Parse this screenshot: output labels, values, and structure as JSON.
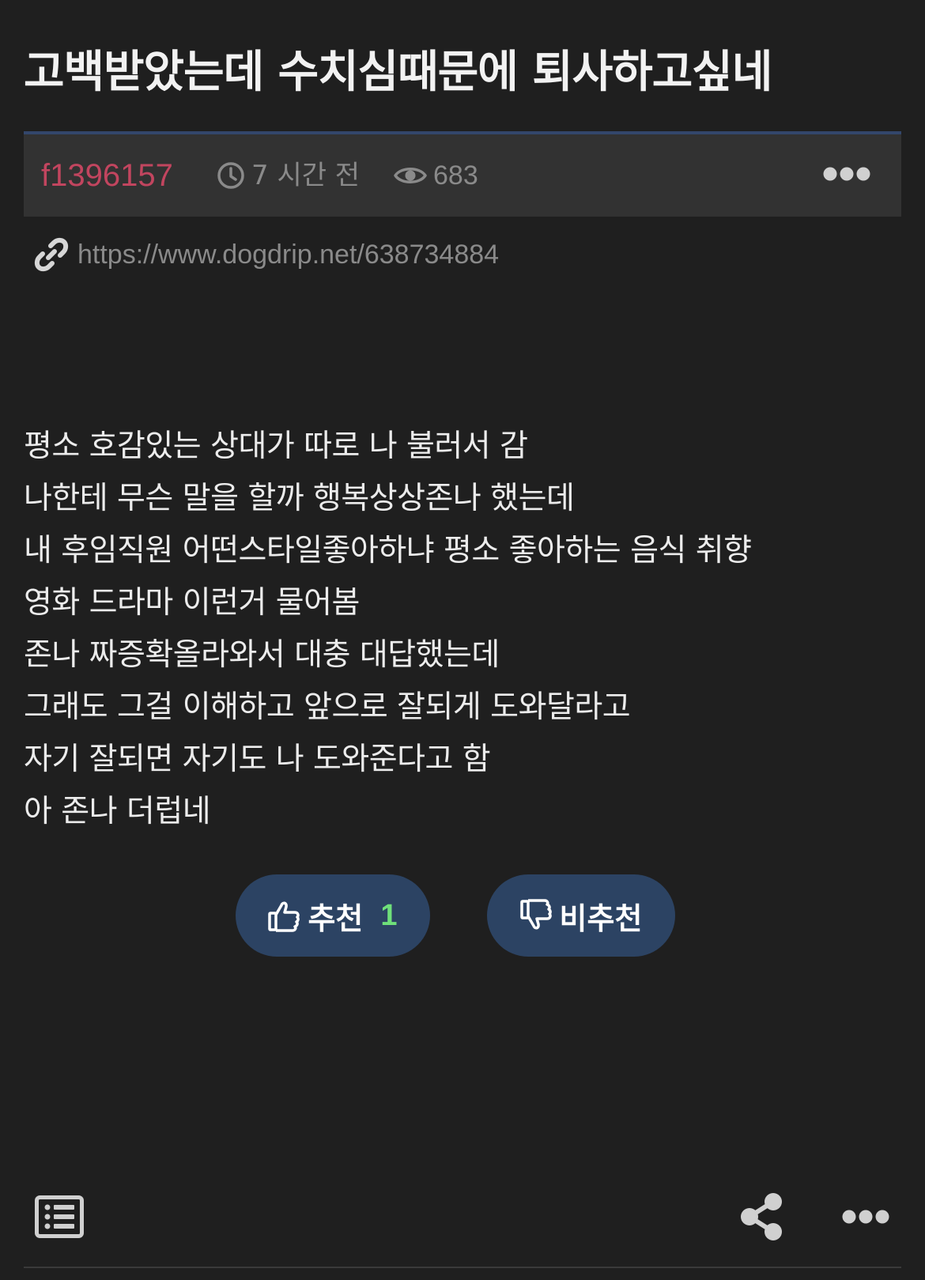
{
  "post": {
    "title": "고백받았는데 수치심때문에 퇴사하고싶네",
    "author": "f1396157",
    "time": "7 시간 전",
    "views": "683",
    "url": "https://www.dogdrip.net/638734884",
    "content_lines": [
      "평소 호감있는 상대가 따로 나 불러서 감",
      "나한테 무슨 말을 할까 행복상상존나 했는데",
      "내 후임직원 어떤스타일좋아하냐 평소 좋아하는 음식 취향",
      "영화 드라마 이런거 물어봄",
      "존나 짜증확올라와서 대충 대답했는데",
      "그래도 그걸 이해하고 앞으로 잘되게 도와달라고",
      "자기 잘되면 자기도 나 도와준다고 함",
      "아 존나 더럽네"
    ]
  },
  "votes": {
    "upvote_label": "추천",
    "upvote_count": "1",
    "downvote_label": "비추천"
  },
  "icons": {
    "time": "clock-icon",
    "views": "eye-icon",
    "link": "link-icon",
    "more": "more-dots-icon",
    "upvote": "thumbs-up-icon",
    "downvote": "thumbs-down-icon",
    "list": "list-icon",
    "share": "share-icon"
  },
  "colors": {
    "background": "#1f1f1f",
    "meta_bar": "#323232",
    "meta_bar_accent": "#33466b",
    "author": "#c2455f",
    "muted": "#8a8a8a",
    "vote_button": "#2c4363",
    "vote_count": "#6fe07a"
  }
}
